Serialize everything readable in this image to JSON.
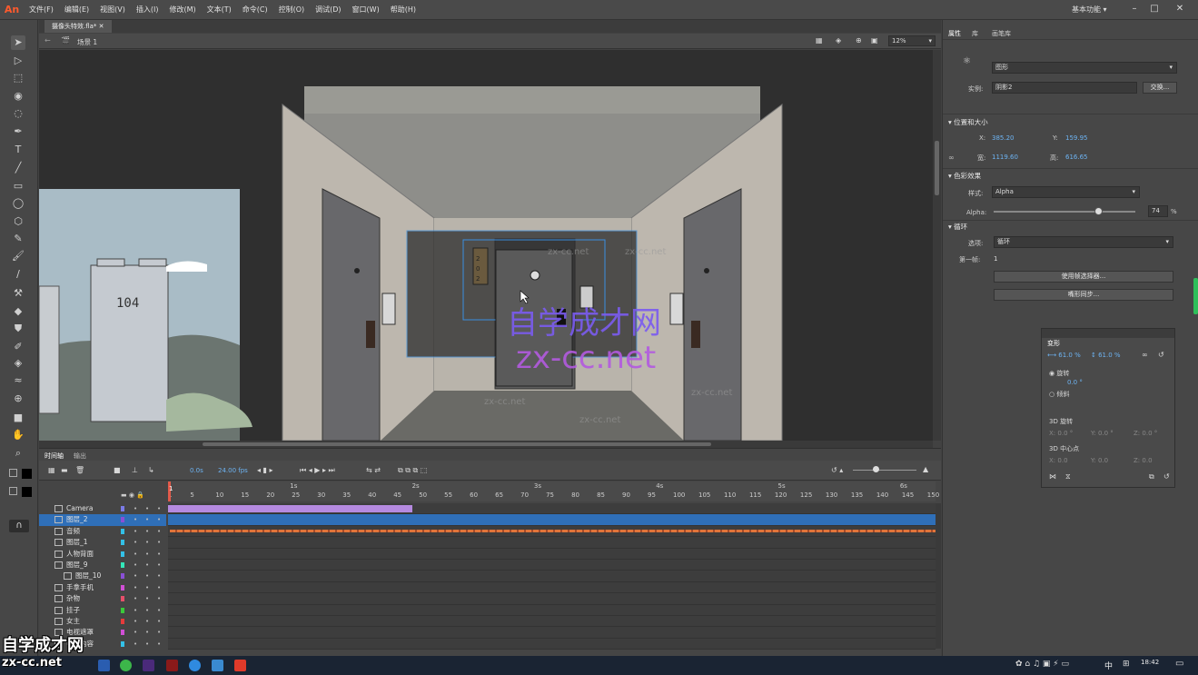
{
  "app": {
    "logo": "An",
    "menu": [
      "文件(F)",
      "编辑(E)",
      "视图(V)",
      "插入(I)",
      "修改(M)",
      "文本(T)",
      "命令(C)",
      "控制(O)",
      "调试(D)",
      "窗口(W)",
      "帮助(H)"
    ],
    "workspace": "基本功能"
  },
  "document": {
    "tab_label": "摄像头特效.fla*",
    "scene_label": "场景 1",
    "zoom": "12%"
  },
  "stage": {
    "building_label": "104",
    "door_number": "202",
    "watermark_cn": "自学成才网",
    "watermark_url": "zx-cc.net",
    "watermark_small": "zx-cc.net"
  },
  "properties": {
    "tabs": [
      "属性",
      "库",
      "画笔库"
    ],
    "instance_type": "图形",
    "instance_label": "实例:",
    "instance_value": "阴影2",
    "swap_button": "交换...",
    "pos_section": "位置和大小",
    "x_label": "X:",
    "x_value": "385.20",
    "y_label": "Y:",
    "y_value": "159.95",
    "w_label": "宽:",
    "w_value": "1119.60",
    "h_label": "高:",
    "h_value": "616.65",
    "color_section": "色彩效果",
    "style_label": "样式:",
    "style_value": "Alpha",
    "alpha_label": "Alpha:",
    "alpha_value": "74",
    "alpha_unit": "%",
    "alpha_fraction": 0.74,
    "loop_section": "循环",
    "options_label": "选项:",
    "options_value": "循环",
    "first_frame_label": "第一帧:",
    "first_frame_value": "1",
    "frame_picker_button": "使用帧选择器...",
    "sync_button": "嘴形同步..."
  },
  "transform": {
    "title": "变形",
    "scale_w": "61.0 %",
    "scale_h": "61.0 %",
    "rotate_label": "旋转",
    "rotate_value": "0.0 °",
    "skew_label": "倾斜",
    "rot3d_label": "3D 旋转",
    "center3d_label": "3D 中心点",
    "x3": "X:",
    "y3": "Y:",
    "z3": "Z:",
    "zero_deg": "0.0 °",
    "zero": "0.0"
  },
  "timeline": {
    "tabs": [
      "时间轴",
      "输出"
    ],
    "frame": "0.0s",
    "fps": "24.00 fps",
    "current_frame": "1",
    "ruler": [
      "1",
      "5",
      "10",
      "15",
      "20",
      "25",
      "30",
      "35",
      "40",
      "45",
      "50",
      "55",
      "60",
      "65",
      "70",
      "75",
      "80",
      "85",
      "90",
      "95",
      "100",
      "105",
      "110",
      "115",
      "120",
      "125",
      "130",
      "135",
      "140",
      "145",
      "150"
    ],
    "seconds": [
      "1s",
      "2s",
      "3s",
      "4s",
      "5s",
      "6s"
    ],
    "layers": [
      {
        "name": "Camera",
        "color": "#7b7be6",
        "selected": false,
        "indent": false
      },
      {
        "name": "图层_2",
        "color": "#8a4fd6",
        "selected": true,
        "indent": false
      },
      {
        "name": "音频",
        "color": "#33c0e6",
        "selected": false,
        "indent": false
      },
      {
        "name": "图层_1",
        "color": "#33c0e6",
        "selected": false,
        "indent": false
      },
      {
        "name": "人物背面",
        "color": "#33c0e6",
        "selected": false,
        "indent": false
      },
      {
        "name": "图层_9",
        "color": "#33e6b8",
        "selected": false,
        "indent": false
      },
      {
        "name": "图层_10",
        "color": "#8a4fd6",
        "selected": false,
        "indent": true
      },
      {
        "name": "手拿手机",
        "color": "#d14fd6",
        "selected": false,
        "indent": false
      },
      {
        "name": "杂物",
        "color": "#e64f6a",
        "selected": false,
        "indent": false
      },
      {
        "name": "挂子",
        "color": "#3bc93b",
        "selected": false,
        "indent": false
      },
      {
        "name": "女主",
        "color": "#e63b3b",
        "selected": false,
        "indent": false
      },
      {
        "name": "电视遮罩",
        "color": "#d14fd6",
        "selected": false,
        "indent": false
      },
      {
        "name": "电视内容",
        "color": "#33c0e6",
        "selected": false,
        "indent": false
      }
    ]
  },
  "taskbar": {
    "lang": "中",
    "time": "18:42"
  },
  "overlay": {
    "logo_cn": "自学成才网",
    "logo_url": "zx-cc.net"
  }
}
